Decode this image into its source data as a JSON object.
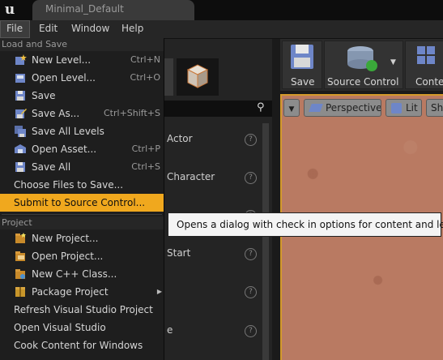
{
  "window": {
    "tab_title": "Minimal_Default"
  },
  "menubar": {
    "items": [
      "File",
      "Edit",
      "Window",
      "Help"
    ],
    "active": "File"
  },
  "file_menu": {
    "load_save_header": "Load and Save",
    "load_save_items": [
      {
        "label": "New Level...",
        "shortcut": "Ctrl+N",
        "icon": "new-level-icon"
      },
      {
        "label": "Open Level...",
        "shortcut": "Ctrl+O",
        "icon": "open-level-icon"
      },
      {
        "label": "Save",
        "shortcut": "",
        "icon": "save-icon"
      },
      {
        "label": "Save As...",
        "shortcut": "Ctrl+Shift+S",
        "icon": "save-as-icon"
      },
      {
        "label": "Save All Levels",
        "shortcut": "",
        "icon": "save-all-levels-icon"
      },
      {
        "label": "Open Asset...",
        "shortcut": "Ctrl+P",
        "icon": "open-asset-icon"
      },
      {
        "label": "Save All",
        "shortcut": "Ctrl+S",
        "icon": "save-all-icon"
      },
      {
        "label": "Choose Files to Save...",
        "shortcut": "",
        "icon": ""
      },
      {
        "label": "Submit to Source Control...",
        "shortcut": "",
        "icon": "",
        "highlighted": true
      }
    ],
    "project_header": "Project",
    "project_items": [
      {
        "label": "New Project...",
        "icon": "new-project-icon"
      },
      {
        "label": "Open Project...",
        "icon": "open-project-icon"
      },
      {
        "label": "New C++ Class...",
        "icon": "cpp-class-icon"
      },
      {
        "label": "Package Project",
        "icon": "package-icon",
        "submenu": true
      },
      {
        "label": "Refresh Visual Studio Project",
        "icon": ""
      },
      {
        "label": "Open Visual Studio",
        "icon": ""
      },
      {
        "label": "Cook Content for Windows",
        "icon": ""
      }
    ]
  },
  "tooltip": "Opens a dialog with check in options for content and levels",
  "place_panel": {
    "labels": [
      "Actor",
      "Character",
      "Start",
      "e"
    ]
  },
  "toolbar": {
    "save_label": "Save",
    "source_control_label": "Source Control",
    "content_label": "Conter"
  },
  "viewport": {
    "perspective_label": "Perspective",
    "lit_label": "Lit",
    "show_label": "Sh"
  },
  "colors": {
    "highlight": "#f0a81e",
    "viewport_border": "#d49a2a"
  }
}
